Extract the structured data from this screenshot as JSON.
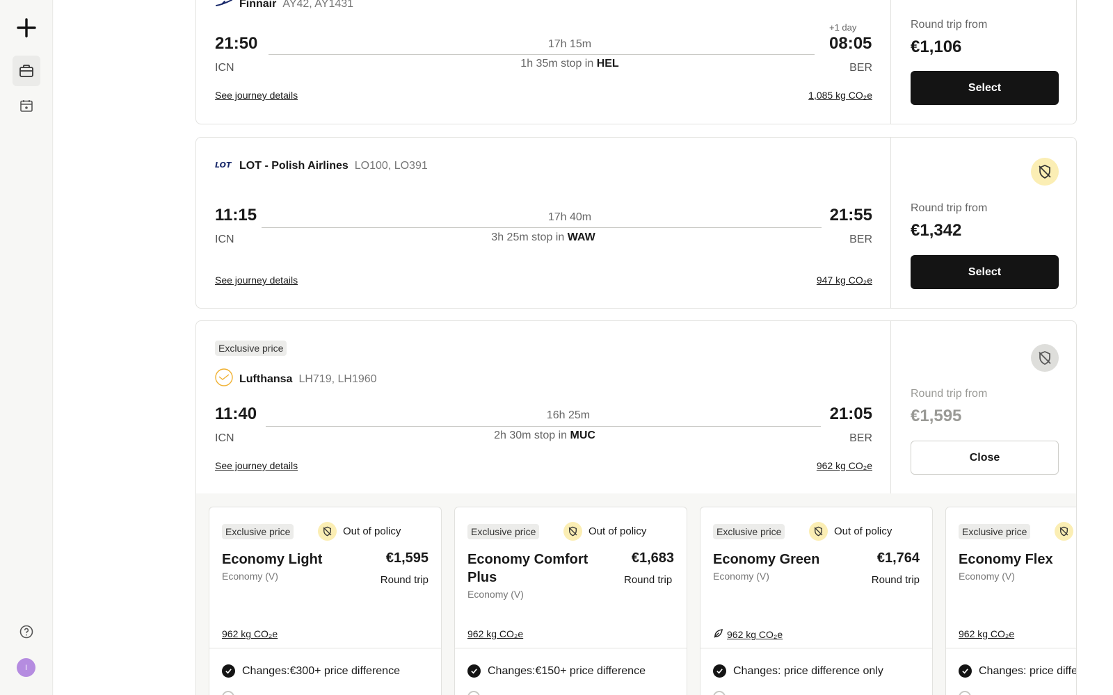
{
  "flights": [
    {
      "airline": "Finnair",
      "flight_numbers": "AY42, AY1431",
      "depart_time": "21:50",
      "depart_airport": "ICN",
      "arrive_time": "08:05",
      "arrive_airport": "BER",
      "plus_day": "+1 day",
      "duration": "17h 15m",
      "stop_text": "1h 35m stop in",
      "stop_airport": "HEL",
      "details_link": "See journey details",
      "co2": "1,085 kg CO₂e",
      "price_label": "Round trip from",
      "price": "€1,106",
      "action_label": "Select"
    },
    {
      "airline": "LOT - Polish Airlines",
      "flight_numbers": "LO100, LO391",
      "depart_time": "11:15",
      "depart_airport": "ICN",
      "arrive_time": "21:55",
      "arrive_airport": "BER",
      "duration": "17h 40m",
      "stop_text": "3h 25m stop in",
      "stop_airport": "WAW",
      "details_link": "See journey details",
      "co2": "947 kg CO₂e",
      "price_label": "Round trip from",
      "price": "€1,342",
      "action_label": "Select"
    },
    {
      "tag": "Exclusive price",
      "airline": "Lufthansa",
      "flight_numbers": "LH719, LH1960",
      "depart_time": "11:40",
      "depart_airport": "ICN",
      "arrive_time": "21:05",
      "arrive_airport": "BER",
      "duration": "16h 25m",
      "stop_text": "2h 30m stop in",
      "stop_airport": "MUC",
      "details_link": "See journey details",
      "co2": "962 kg CO₂e",
      "price_label": "Round trip from",
      "price": "€1,595",
      "action_label": "Close"
    }
  ],
  "fares": [
    {
      "tag": "Exclusive price",
      "policy": "Out of policy",
      "name": "Economy Light",
      "class": "Economy (V)",
      "price": "€1,595",
      "price_note": "Round trip",
      "co2": "962 kg CO₂e",
      "feature": "Changes:€300+ price difference"
    },
    {
      "tag": "Exclusive price",
      "policy": "Out of policy",
      "name": "Economy Comfort Plus",
      "class": "Economy (V)",
      "price": "€1,683",
      "price_note": "Round trip",
      "co2": "962 kg CO₂e",
      "feature": "Changes:€150+ price difference"
    },
    {
      "tag": "Exclusive price",
      "policy": "Out of policy",
      "name": "Economy Green",
      "class": "Economy (V)",
      "price": "€1,764",
      "price_note": "Round trip",
      "co2": "962 kg CO₂e",
      "feature": "Changes: price difference only"
    },
    {
      "tag": "Exclusive price",
      "policy": "",
      "name": "Economy Flex",
      "class": "Economy (V)",
      "price": "",
      "price_note": "",
      "co2": "962 kg CO₂e",
      "feature": "Changes: price difference only"
    }
  ],
  "user": {
    "initial": "I"
  },
  "icons": {
    "rail_logo": "plus-logo-icon",
    "trips": "briefcase-icon",
    "calendar": "calendar-icon",
    "help": "help-icon",
    "policy": "shield-off-icon",
    "eco": "leaf-icon",
    "check": "check-circle-icon"
  },
  "colors": {
    "primary_button": "#141414",
    "policy_warning": "#fbeeb4",
    "policy_neutral": "#dededb",
    "avatar": "#b58ce0"
  }
}
